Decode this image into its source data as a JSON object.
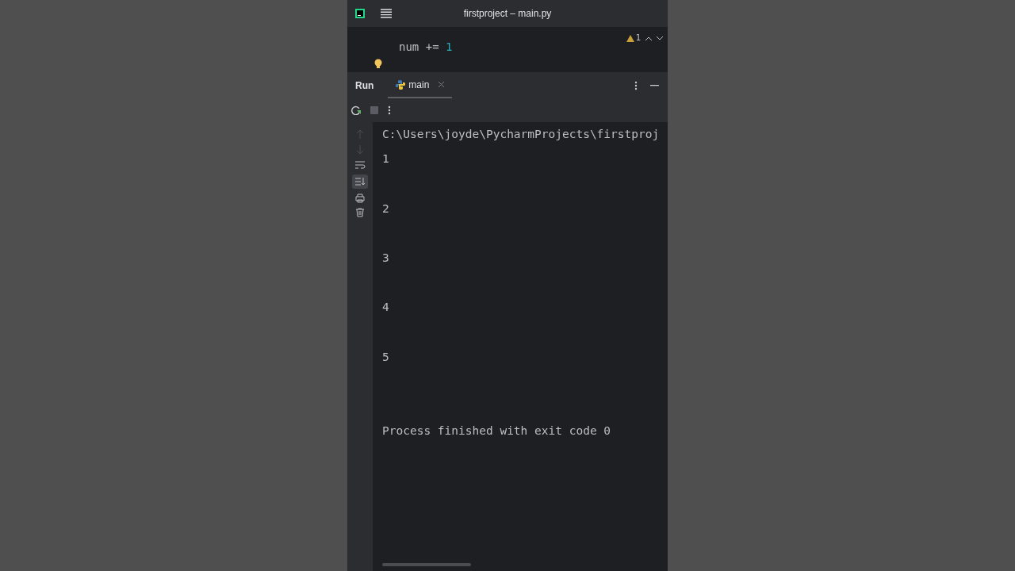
{
  "window": {
    "title": "firstproject – main.py"
  },
  "editor": {
    "lines": [
      {
        "tokens": [
          {
            "text": "num += ",
            "kind": "plain"
          },
          {
            "text": "1",
            "kind": "number"
          }
        ]
      }
    ],
    "warnings": "1"
  },
  "run_panel": {
    "title": "Run",
    "tabs": [
      {
        "label": "main",
        "selected": true
      }
    ]
  },
  "console": {
    "lines": [
      {
        "kind": "text",
        "text": "C:\\Users\\joyde\\PycharmProjects\\firstproj"
      },
      {
        "kind": "text",
        "text": "1"
      },
      {
        "kind": "blank"
      },
      {
        "kind": "text",
        "text": "2"
      },
      {
        "kind": "blank"
      },
      {
        "kind": "text",
        "text": "3"
      },
      {
        "kind": "blank"
      },
      {
        "kind": "text",
        "text": "4"
      },
      {
        "kind": "blank"
      },
      {
        "kind": "text",
        "text": "5"
      },
      {
        "kind": "blank"
      },
      {
        "kind": "blank"
      },
      {
        "kind": "text",
        "text": "Process finished with exit code 0"
      }
    ]
  }
}
